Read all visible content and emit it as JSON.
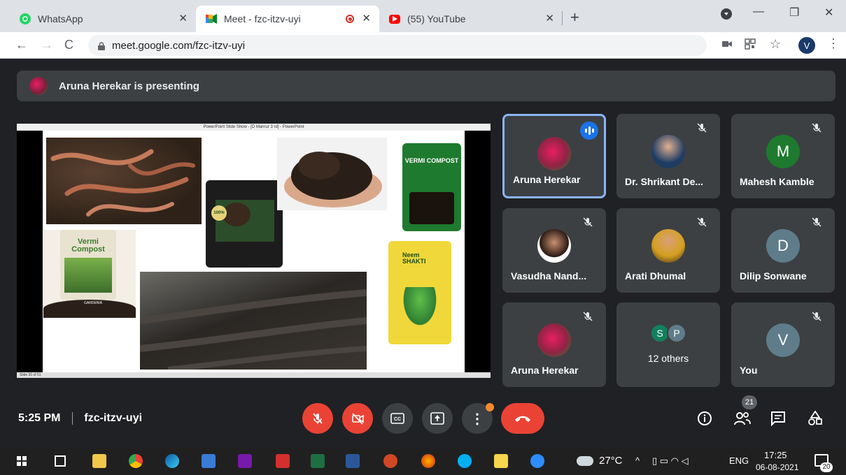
{
  "tabs": [
    {
      "title": "WhatsApp",
      "icon": "whatsapp-icon"
    },
    {
      "title": "Meet - fzc-itzv-uyi",
      "icon": "meet-icon"
    },
    {
      "title": "(55) YouTube",
      "icon": "youtube-icon"
    }
  ],
  "address": {
    "url": "meet.google.com/fzc-itzv-uyi"
  },
  "profile_initial": "V",
  "presenting_banner": "Aruna Herekar is presenting",
  "slide": {
    "window_title": "PowerPoint Slide Show - [D Manrur 3 rd] - PowerPoint",
    "status": "Slide 20 of 51",
    "bag_labels": {
      "vermi_top": "VERMI COMPOST",
      "vermi_left": "Vermi Compost",
      "gardenia": "GARDENIA",
      "neem": "Neem SHAKTI",
      "badge": "100%"
    }
  },
  "participants": [
    {
      "name": "Aruna Herekar",
      "avatar": "flower"
    },
    {
      "name": "Dr. Shrikant De...",
      "avatar": "photo"
    },
    {
      "name": "Mahesh Kamble",
      "initial": "M",
      "color": "#1e7a2e"
    },
    {
      "name": "Vasudha Nand...",
      "avatar": "photo"
    },
    {
      "name": "Arati Dhumal",
      "avatar": "photo"
    },
    {
      "name": "Dilip Sonwane",
      "initial": "D",
      "color": "#5f7c8a"
    },
    {
      "name": "Aruna Herekar",
      "avatar": "flower"
    },
    {
      "name": "12 others",
      "initials": [
        "S",
        "P"
      ]
    },
    {
      "name": "You",
      "initial": "V",
      "color": "#5f7c8a"
    }
  ],
  "meeting": {
    "time": "5:25 PM",
    "code": "fzc-itzv-uyi",
    "participant_count": "21"
  },
  "taskbar": {
    "weather": "27°C",
    "lang": "ENG",
    "time": "17:25",
    "date": "06-08-2021",
    "notifications": "20"
  },
  "colors": {
    "end_call": "#ea4335",
    "muted": "#ea4335",
    "ctrl": "#3c4043",
    "accent": "#8ab4f8"
  }
}
